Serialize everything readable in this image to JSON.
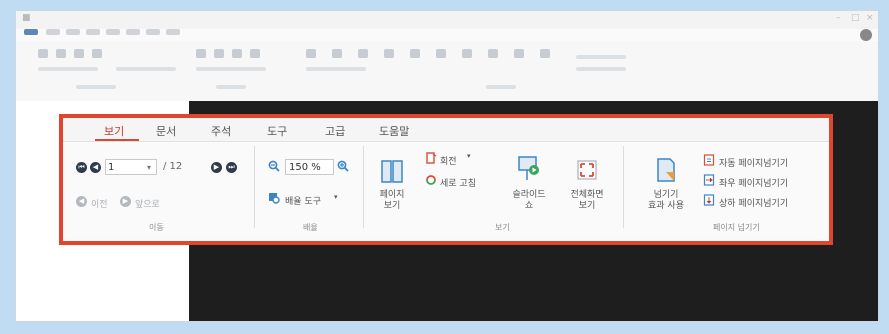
{
  "tabs": [
    "보기",
    "문서",
    "주석",
    "도구",
    "고급",
    "도움말"
  ],
  "navigation": {
    "page_value": "1",
    "total": "/ 12",
    "back_label": "이전",
    "forward_label": "앞으로",
    "group_label": "이동"
  },
  "zoom": {
    "value": "150 %",
    "tool_label": "배율 도구",
    "group_label": "배율"
  },
  "view": {
    "page_view_label": [
      "페이지",
      "보기"
    ],
    "rotate_label": "회전",
    "vertical_label": "세로 고침",
    "slideshow_label": [
      "슬라이드",
      "쇼"
    ],
    "fullscreen_label": [
      "전체화면",
      "보기"
    ],
    "group_label": "보기"
  },
  "page_turn": {
    "effect_label": [
      "넘기기",
      "효과 사용"
    ],
    "auto_label": "자동 페이지넘기기",
    "left_right_label": "좌우 페이지넘기기",
    "up_down_label": "상하 페이지넘기기",
    "group_label": "페이지 넘기기"
  },
  "colors": {
    "highlight_border": "#e0462d",
    "active_tab": "#c53a2a",
    "icon_blue": "#3a86c8",
    "icon_green": "#3aa55c",
    "icon_red": "#d94b3a"
  }
}
